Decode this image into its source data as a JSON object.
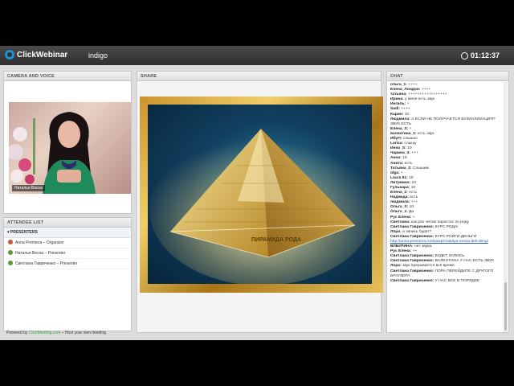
{
  "app": {
    "logo": "ClickWebinar",
    "room": "indigo",
    "timer": "01:12:37"
  },
  "camera": {
    "title": "CAMERA AND VOICE",
    "name_label": "Наталья Вясна"
  },
  "attendees": {
    "title": "ATTENDEE LIST",
    "group": "PRESENTERS",
    "items": [
      {
        "name": "Anna Premiera – Organizer",
        "color": "#c05a3a"
      },
      {
        "name": "Наталья Весна – Presenter",
        "color": "#5a9a3a"
      },
      {
        "name": "Светлана Гавриченко – Presenter",
        "color": "#5a9a3a"
      }
    ]
  },
  "share": {
    "title": "SHARE",
    "pyramid_label": "ПИРАМИДА РОДА"
  },
  "chat": {
    "title": "CHAT",
    "messages": [
      {
        "user": "ольга_1:",
        "text": "++++"
      },
      {
        "user": "Елена_Лондон:",
        "text": "++++"
      },
      {
        "user": "татьяна:",
        "text": "+++++++++++++++++"
      },
      {
        "user": "Ирина:",
        "text": "у меня есть звук"
      },
      {
        "user": "Ингиль:",
        "text": "+"
      },
      {
        "user": "Sadi:",
        "text": "++++"
      },
      {
        "user": "Карин:",
        "text": "10"
      },
      {
        "user": "Людмила:",
        "text": "А ЕСЛИ НЕ ПОЛУЧАЕТСЯ БУЗИАЛИЗАЦИЯ? ЗВУК ЕСТЬ"
      },
      {
        "user": "Елена_S:",
        "text": "+"
      },
      {
        "user": "валентина_1:",
        "text": "есть звук"
      },
      {
        "user": "ИбуП:",
        "text": "слышно"
      },
      {
        "user": "Larisa:",
        "text": "слышу"
      },
      {
        "user": "Инна_S:",
        "text": "10"
      },
      {
        "user": "Чарина_4:",
        "text": "+++"
      },
      {
        "user": "Анна:",
        "text": "10"
      },
      {
        "user": "Анита:",
        "text": "есть"
      },
      {
        "user": "Татьяна_2:",
        "text": "Слышим"
      },
      {
        "user": "olga:",
        "text": "+"
      },
      {
        "user": "Laura 51:",
        "text": "10"
      },
      {
        "user": "Литрвина:",
        "text": "10"
      },
      {
        "user": "Гульнара:",
        "text": "10"
      },
      {
        "user": "Елена_2:",
        "text": "есть"
      },
      {
        "user": "Надежда:",
        "text": "есть"
      },
      {
        "user": "людмила:",
        "text": "+++"
      },
      {
        "user": "Ольга_S:",
        "text": "10"
      },
      {
        "user": "Ольга_1:",
        "text": "Да"
      },
      {
        "user": "Рус Елена:",
        "text": "+"
      },
      {
        "user": "Светлана:",
        "text": "как раз читаю парастас по роду"
      },
      {
        "user": "Светлана Гавриченко:",
        "text": "КУРС РОДА!"
      },
      {
        "user": "Лора:",
        "text": "а запись будет?"
      },
      {
        "user": "Светлана Гавриченко:",
        "text": "КУРС РОЙГИ ДЕНЬГИ"
      },
      {
        "user": "",
        "text": "http://anna-premiera.ru/doiaspr/natalya-vesna-deli-dengi",
        "link": true
      },
      {
        "user": "ВЛБУРИНА:",
        "text": "нет звука."
      },
      {
        "user": "Рус Елена:",
        "text": "++"
      },
      {
        "user": "Светлана Гавриченко:",
        "text": "БУДЕТ ЗАПИСЬ"
      },
      {
        "user": "Светлана Гавриченко:",
        "text": "ВАЛЕНТИНА У НАС ЕСТЬ ЗВУК"
      },
      {
        "user": "Лора:",
        "text": "звук прерывается всё время"
      },
      {
        "user": "Светлана Гавриченко:",
        "text": "ЛОРА ПЕРЕЙДИТЕ С ДРУГОГО БРАУЗЕРА"
      },
      {
        "user": "Светлана Гавриченко:",
        "text": "У НАС ВСЕ В ПОРЯДКЕ"
      }
    ]
  },
  "footer": {
    "prefix": "Powered by",
    "brand": "ClickMeeting.com",
    "suffix": "– Host your own meeting"
  }
}
